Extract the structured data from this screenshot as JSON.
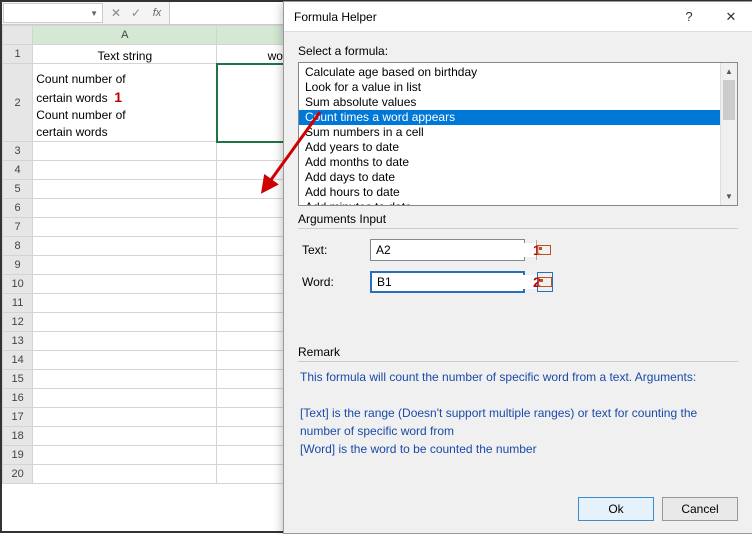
{
  "sheet": {
    "headers": {
      "a": "Text string",
      "b": "words"
    },
    "annotations": {
      "cell_a2": "1",
      "cell_b1": "2"
    },
    "a2_text": "Count number of certain words  Count number of certain words",
    "row_count": 20
  },
  "dialog": {
    "title": "Formula Helper",
    "select_label": "Select a formula:",
    "formulas": [
      "Calculate age based on birthday",
      "Look for a value in list",
      "Sum absolute values",
      "Count times a word appears",
      "Sum numbers in a cell",
      "Add years to date",
      "Add months to date",
      "Add days to date",
      "Add hours to date",
      "Add minutes to date"
    ],
    "selected_index": 3,
    "args_title": "Arguments Input",
    "args": {
      "text_label": "Text:",
      "text_value": "A2",
      "text_ann": "1",
      "word_label": "Word:",
      "word_value": "B1",
      "word_ann": "2"
    },
    "remark_title": "Remark",
    "remark_lines": [
      "This formula will count the number of specific word from a text. Arguments:",
      "",
      "[Text] is the range (Doesn't support multiple ranges) or text for counting the number of specific word from",
      "[Word] is the word to be counted the number"
    ],
    "ok": "Ok",
    "cancel": "Cancel"
  }
}
